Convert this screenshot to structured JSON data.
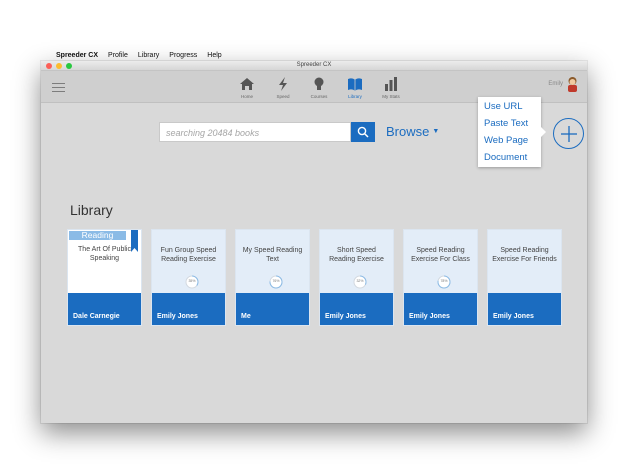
{
  "menubar": {
    "app_name": "Spreeder CX",
    "items": [
      "Profile",
      "Library",
      "Progress",
      "Help"
    ]
  },
  "window": {
    "title": "Spreeder CX"
  },
  "nav": [
    {
      "label": "Home",
      "icon": "home-icon"
    },
    {
      "label": "Speed",
      "icon": "speed-icon"
    },
    {
      "label": "Courses",
      "icon": "lightbulb-icon"
    },
    {
      "label": "Library",
      "icon": "book-icon",
      "active": true
    },
    {
      "label": "My Stats",
      "icon": "stats-icon"
    }
  ],
  "user": {
    "name": "Emily"
  },
  "search": {
    "placeholder": "searching 20484 books"
  },
  "browse": {
    "label": "Browse"
  },
  "add_menu": {
    "items": [
      "Use URL",
      "Paste Text",
      "Web Page",
      "Document"
    ]
  },
  "library": {
    "heading": "Library",
    "reading_badge": "Reading",
    "cards": [
      {
        "title": "The Art Of Public Speaking",
        "author": "Dale Carnegie",
        "progress": null,
        "reading": true
      },
      {
        "title": "Fun Group Speed Reading Exercise",
        "author": "Emily Jones",
        "progress": "35%",
        "progress_value": 35
      },
      {
        "title": "My Speed Reading Text",
        "author": "Me",
        "progress": "76%",
        "progress_value": 76
      },
      {
        "title": "Short Speed Reading Exercise",
        "author": "Emily Jones",
        "progress": "32%",
        "progress_value": 32
      },
      {
        "title": "Speed Reading Exercise For Class",
        "author": "Emily Jones",
        "progress": "78%",
        "progress_value": 78
      },
      {
        "title": "Speed Reading Exercise For Friends",
        "author": "Emily Jones",
        "progress": null
      }
    ]
  },
  "colors": {
    "accent": "#1b6cc0",
    "card_bg": "#e3edf8",
    "window_bg": "#d9d9d9"
  }
}
